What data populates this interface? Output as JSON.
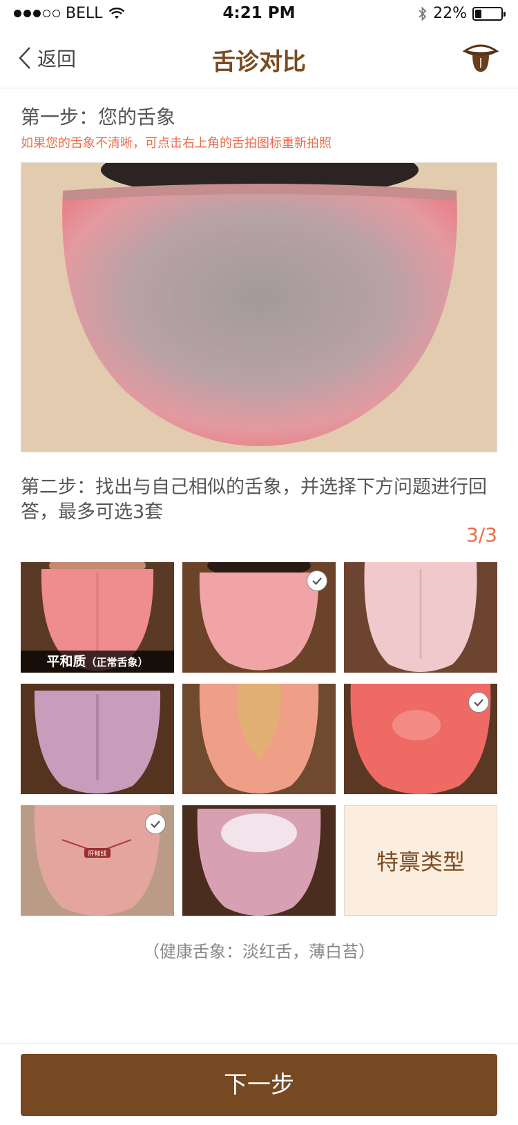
{
  "status_bar": {
    "carrier": "BELL",
    "time": "4:21 PM",
    "battery_percent": "22%",
    "battery_level": 0.22
  },
  "nav": {
    "back_label": "返回",
    "title": "舌诊对比"
  },
  "step1": {
    "title": "第一步：您的舌象",
    "hint": "如果您的舌象不清晰，可点击右上角的舌拍图标重新拍照"
  },
  "step2": {
    "title": "第二步：找出与自己相似的舌象，并选择下方问题进行回答，最多可选3套",
    "counter": "3/3"
  },
  "tiles": [
    {
      "caption_main": "平和质",
      "caption_sub": "（正常舌象）",
      "selected": false
    },
    {
      "caption_main": "",
      "caption_sub": "",
      "selected": true
    },
    {
      "caption_main": "",
      "caption_sub": "",
      "selected": false
    },
    {
      "caption_main": "",
      "caption_sub": "",
      "selected": false
    },
    {
      "caption_main": "",
      "caption_sub": "",
      "selected": false
    },
    {
      "caption_main": "",
      "caption_sub": "",
      "selected": true
    },
    {
      "caption_main": "",
      "caption_sub": "",
      "selected": true,
      "label_on_image": "肝郁线"
    },
    {
      "caption_main": "",
      "caption_sub": "",
      "selected": false
    },
    {
      "special_label": "特禀类型"
    }
  ],
  "healthy_note": "（健康舌象：淡红舌，薄白苔）",
  "next_button": "下一步",
  "colors": {
    "brand_brown": "#764923",
    "accent_red": "#f06a4a",
    "special_bg": "#fbeedf"
  },
  "icons": [
    "back-chevron-icon",
    "tongue-camera-icon",
    "wifi-icon",
    "bluetooth-icon",
    "battery-icon",
    "check-icon"
  ]
}
